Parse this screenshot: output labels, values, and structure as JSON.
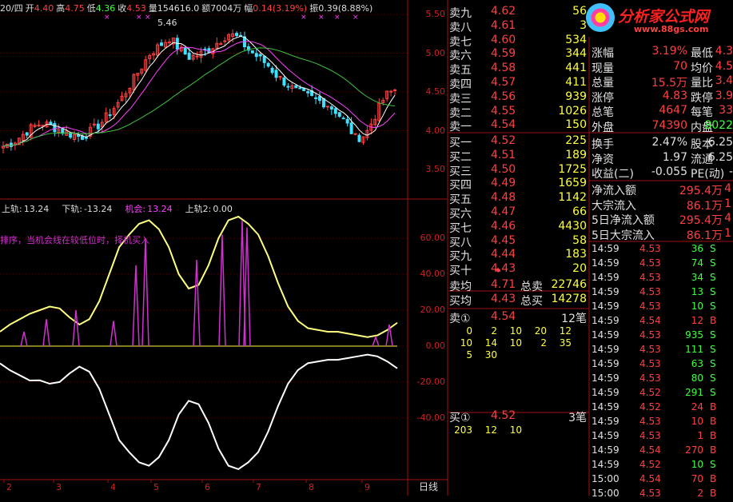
{
  "header": {
    "date": "20/四",
    "open_label": "开",
    "open": "4.40",
    "high_label": "高",
    "high": "4.75",
    "low_label": "低",
    "low": "4.36",
    "close_label": "收",
    "close": "4.53",
    "vol_label": "量",
    "vol": "154616.0",
    "amt_label": "额",
    "amt": "7004万",
    "chg_label": "幅",
    "chg": "0.14(3.19%)",
    "amp_label": "振",
    "amp": "0.39(8.88%)"
  },
  "price_axis": [
    "5.50",
    "5.00",
    "4.50",
    "4.00",
    "3.50"
  ],
  "peak_label": "5.46",
  "indicator": {
    "upper_label": "上轨:",
    "upper": "13.24",
    "lower_label": "下轨:",
    "lower": "-13.24",
    "chance_label": "机会:",
    "chance": "13.24",
    "upper2_label": "上轨2:",
    "upper2": "0.00",
    "note": "排序，当机会线在较低位时，择机买入"
  },
  "ind_axis": [
    "60.00",
    "40.00",
    "20.00",
    "0.00",
    "-20.00",
    "-40.00"
  ],
  "x_axis": [
    "2",
    "3",
    "4",
    "5",
    "6",
    "7",
    "8",
    "9"
  ],
  "period_button": "日线",
  "logo": {
    "title": "分析家公式网",
    "url": "www.88gs.com"
  },
  "asks": [
    {
      "label": "卖九",
      "price": "4.62",
      "vol": "56"
    },
    {
      "label": "卖八",
      "price": "4.61",
      "vol": "3"
    },
    {
      "label": "卖七",
      "price": "4.60",
      "vol": "534"
    },
    {
      "label": "卖六",
      "price": "4.59",
      "vol": "344"
    },
    {
      "label": "卖五",
      "price": "4.58",
      "vol": "441"
    },
    {
      "label": "卖四",
      "price": "4.57",
      "vol": "411"
    },
    {
      "label": "卖三",
      "price": "4.56",
      "vol": "939"
    },
    {
      "label": "卖二",
      "price": "4.55",
      "vol": "1026"
    },
    {
      "label": "卖一",
      "price": "4.54",
      "vol": "150"
    }
  ],
  "bids": [
    {
      "label": "买一",
      "price": "4.52",
      "vol": "225"
    },
    {
      "label": "买二",
      "price": "4.51",
      "vol": "189"
    },
    {
      "label": "买三",
      "price": "4.50",
      "vol": "1725"
    },
    {
      "label": "买四",
      "price": "4.49",
      "vol": "1659"
    },
    {
      "label": "买五",
      "price": "4.48",
      "vol": "1142"
    },
    {
      "label": "买六",
      "price": "4.47",
      "vol": "66"
    },
    {
      "label": "买七",
      "price": "4.46",
      "vol": "4430"
    },
    {
      "label": "买八",
      "price": "4.45",
      "vol": "58"
    },
    {
      "label": "买九",
      "price": "4.44",
      "vol": "183"
    },
    {
      "label": "买十",
      "price": "4.43",
      "vol": "20"
    }
  ],
  "summary": {
    "ask_avg_label": "卖均",
    "ask_avg": "4.71",
    "total_sell_label": "总卖",
    "total_sell": "22746",
    "bid_avg_label": "买均",
    "bid_avg": "4.43",
    "total_buy_label": "总买",
    "total_buy": "14278"
  },
  "sell_queue": {
    "label": "卖①",
    "price": "4.54",
    "count": "12笔",
    "rows": [
      [
        "0",
        "2",
        "10",
        "20",
        "12"
      ],
      [
        "10",
        "14",
        "10",
        "2",
        "35"
      ],
      [
        "5",
        "30"
      ]
    ]
  },
  "buy_queue": {
    "label": "买①",
    "price": "4.52",
    "count": "3笔",
    "rows": [
      [
        "203",
        "12",
        "10"
      ]
    ]
  },
  "stats": [
    {
      "l1": "涨幅",
      "v1": "3.19%",
      "l2": "最低",
      "v2": "4.3"
    },
    {
      "l1": "现量",
      "v1": "70",
      "l2": "均价",
      "v2": "4.5"
    },
    {
      "l1": "总量",
      "v1": "15.5万",
      "l2": "量比",
      "v2": "3.4"
    },
    {
      "l1": "涨停",
      "v1": "4.83",
      "l2": "跌停",
      "v2": "3.9"
    },
    {
      "l1": "总笔",
      "v1": "4647",
      "l2": "每笔",
      "v2": "33"
    },
    {
      "l1": "外盘",
      "v1": "74390",
      "l2": "内盘",
      "v2": "8022"
    }
  ],
  "stats2": [
    {
      "l1": "换手",
      "v1": "2.47%",
      "l2": "股本",
      "v2": "6.25"
    },
    {
      "l1": "净资",
      "v1": "1.97",
      "l2": "流通",
      "v2": "6.25"
    },
    {
      "l1": "收益(二)",
      "v1": "-0.055",
      "l2": "PE(动)",
      "v2": "-"
    }
  ],
  "flows": [
    {
      "label": "净流入额",
      "value": "295.4万",
      "extra": "4"
    },
    {
      "label": "大宗流入",
      "value": "86.1万",
      "extra": "1"
    },
    {
      "label": "5日净流入额",
      "value": "295.4万",
      "extra": "4"
    },
    {
      "label": "5日大宗流入",
      "value": "86.1万",
      "extra": "1"
    }
  ],
  "trades": [
    {
      "t": "14:59",
      "p": "4.53",
      "v": "36",
      "d": "S"
    },
    {
      "t": "14:59",
      "p": "4.53",
      "v": "74",
      "d": "S"
    },
    {
      "t": "14:59",
      "p": "4.53",
      "v": "34",
      "d": "S"
    },
    {
      "t": "14:59",
      "p": "4.53",
      "v": "13",
      "d": "S"
    },
    {
      "t": "14:59",
      "p": "4.53",
      "v": "10",
      "d": "S"
    },
    {
      "t": "14:59",
      "p": "4.54",
      "v": "12",
      "d": "B"
    },
    {
      "t": "14:59",
      "p": "4.53",
      "v": "935",
      "d": "S"
    },
    {
      "t": "14:59",
      "p": "4.53",
      "v": "111",
      "d": "S"
    },
    {
      "t": "14:59",
      "p": "4.53",
      "v": "63",
      "d": "S"
    },
    {
      "t": "14:59",
      "p": "4.53",
      "v": "80",
      "d": "S"
    },
    {
      "t": "14:59",
      "p": "4.52",
      "v": "291",
      "d": "S"
    },
    {
      "t": "14:59",
      "p": "4.52",
      "v": "24",
      "d": "B"
    },
    {
      "t": "14:59",
      "p": "4.53",
      "v": "10",
      "d": "B"
    },
    {
      "t": "14:59",
      "p": "4.53",
      "v": "1",
      "d": "B"
    },
    {
      "t": "14:59",
      "p": "4.54",
      "v": "270",
      "d": "B"
    },
    {
      "t": "14:59",
      "p": "4.52",
      "v": "10",
      "d": "S"
    },
    {
      "t": "15:00",
      "p": "4.54",
      "v": "70",
      "d": "B"
    },
    {
      "t": "15:00",
      "p": "4.53",
      "v": "2",
      "d": "B"
    }
  ],
  "colors": {
    "up": "#ff4040",
    "down": "#40ff40",
    "volume": "#ffff40",
    "ma5": "#ffffff",
    "ma10": "#ff40ff",
    "ma20": "#40c040"
  }
}
